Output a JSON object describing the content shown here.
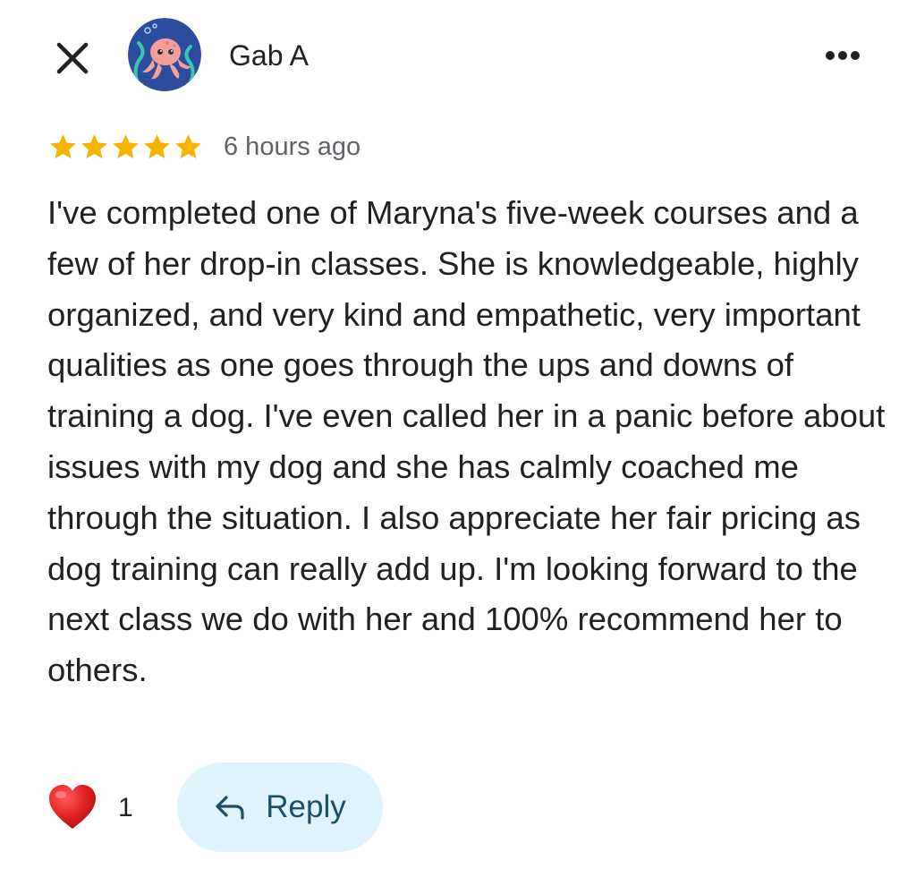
{
  "header": {
    "author_name": "Gab A",
    "close_icon": "close-icon",
    "more_icon": "more-horizontal-icon",
    "avatar_icon": "octopus-avatar"
  },
  "review": {
    "rating": 5,
    "rating_max": 5,
    "star_color": "#f4b400",
    "time_ago": "6 hours ago",
    "text": "I've completed one of Maryna's five-week courses and a few of her drop-in classes. She is knowledgeable, highly organized, and very kind and empathetic, very important qualities as one goes through the ups and downs of training a dog. I've even called her in a panic before about issues with my dog and she has calmly coached me through the situation. I also appreciate her fair pricing as dog training can really add up. I'm looking forward to the next class we do with her and 100% recommend her to others."
  },
  "actions": {
    "like_icon": "red-heart-icon",
    "like_count": "1",
    "reply_icon": "reply-arrow-icon",
    "reply_label": "Reply",
    "reply_bg_color": "#dff3fd"
  }
}
